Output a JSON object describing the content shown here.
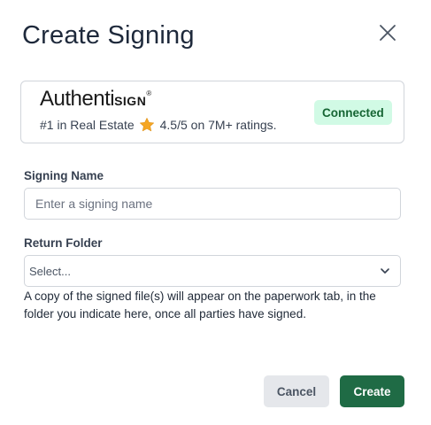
{
  "dialog": {
    "title": "Create Signing",
    "close_icon": "close-icon"
  },
  "provider": {
    "brand_main": "Authenti",
    "brand_small": "SIGN",
    "brand_reg": "®",
    "tagline_prefix": "#1 in Real Estate",
    "rating_icon": "star-icon",
    "rating_color": "#f5a623",
    "tagline_rating": "4.5/5 on 7M+ ratings.",
    "status": "Connected",
    "status_bg": "#d1fae5",
    "status_color": "#166534"
  },
  "form": {
    "signing_name_label": "Signing Name",
    "signing_name_placeholder": "Enter a signing name",
    "signing_name_value": "",
    "return_folder_label": "Return Folder",
    "return_folder_value": "Select...",
    "return_folder_icon": "chevron-down-icon",
    "helper_text": "A copy of the signed file(s) will appear on the paperwork tab, in the folder you indicate here, once all parties have signed."
  },
  "actions": {
    "cancel_label": "Cancel",
    "create_label": "Create",
    "create_color": "#1f6b45"
  }
}
